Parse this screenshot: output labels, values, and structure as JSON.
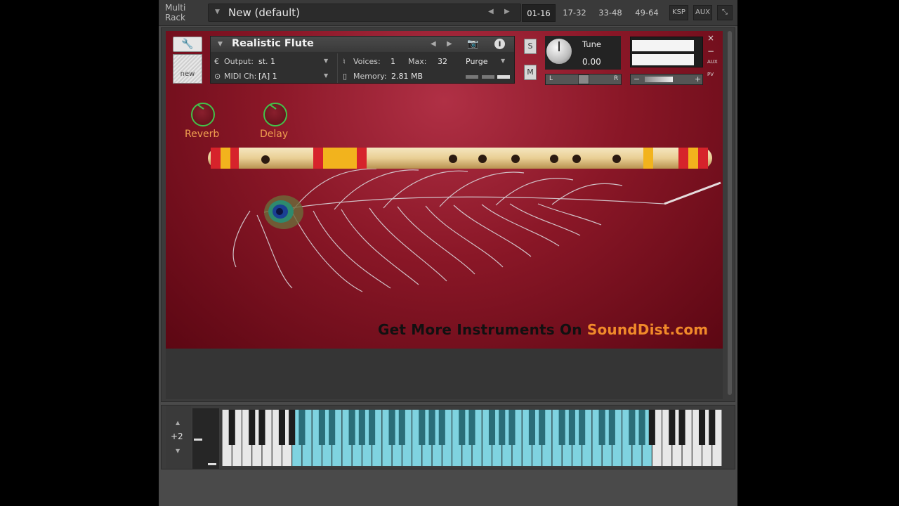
{
  "topbar": {
    "multi_rack_line1": "Multi",
    "multi_rack_line2": "Rack",
    "rack_name": "New (default)",
    "pages": [
      "01-16",
      "17-32",
      "33-48",
      "49-64"
    ],
    "active_page": "01-16",
    "ksp_label": "KSP",
    "aux_label": "AUX"
  },
  "instrument": {
    "name": "Realistic Flute",
    "output_label": "Output:",
    "output_value": "st. 1",
    "voices_label": "Voices:",
    "voices_value": "1",
    "max_label": "Max:",
    "max_value": "32",
    "purge_label": "Purge",
    "midi_label": "MIDI Ch:",
    "midi_value": "[A] 1",
    "memory_label": "Memory:",
    "memory_value": "2.81 MB",
    "new_label": "new",
    "solo_label": "S",
    "mute_label": "M",
    "tune_label": "Tune",
    "tune_value": "0.00",
    "pan_left": "L",
    "pan_right": "R",
    "vol_minus": "−",
    "vol_plus": "+",
    "aux_small": "AUX",
    "pv_small": "PV"
  },
  "effects": {
    "reverb_label": "Reverb",
    "delay_label": "Delay"
  },
  "promo": {
    "prefix": "Get More Instruments On ",
    "highlight": "SoundDist.com"
  },
  "keyboard": {
    "octave_value": "+2"
  },
  "colors": {
    "background_red": "#8a1727",
    "promo_accent": "#f18a2a",
    "knob_green": "#43c24a",
    "key_highlight": "#7fd3e0"
  }
}
